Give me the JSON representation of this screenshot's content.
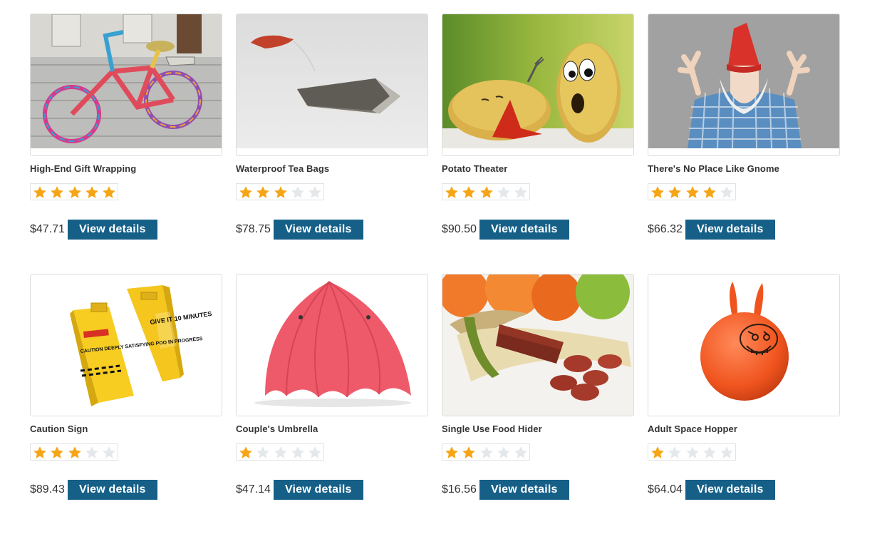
{
  "colors": {
    "star_filled": "#F5A515",
    "star_empty": "#E4E8EB",
    "button_bg": "#166088",
    "button_text": "#FFFFFF"
  },
  "products": [
    {
      "name": "High-End Gift Wrapping",
      "price": "$47.71",
      "rating": 5,
      "button": "View details",
      "image_icon": "knitted-bicycle-photo"
    },
    {
      "name": "Waterproof Tea Bags",
      "price": "$78.75",
      "rating": 3,
      "button": "View details",
      "image_icon": "tea-bag-photo"
    },
    {
      "name": "Potato Theater",
      "price": "$90.50",
      "rating": 3,
      "button": "View details",
      "image_icon": "potatoes-photo"
    },
    {
      "name": "There's No Place Like Gnome",
      "price": "$66.32",
      "rating": 4,
      "button": "View details",
      "image_icon": "gnome-man-photo"
    },
    {
      "name": "Caution Sign",
      "price": "$89.43",
      "rating": 3,
      "button": "View details",
      "image_icon": "caution-sign-photo"
    },
    {
      "name": "Couple's Umbrella",
      "price": "$47.14",
      "rating": 1,
      "button": "View details",
      "image_icon": "umbrella-photo"
    },
    {
      "name": "Single Use Food Hider",
      "price": "$16.56",
      "rating": 2,
      "button": "View details",
      "image_icon": "banana-sausage-photo"
    },
    {
      "name": "Adult Space Hopper",
      "price": "$64.04",
      "rating": 1,
      "button": "View details",
      "image_icon": "space-hopper-photo"
    }
  ],
  "caution_sign_text": {
    "left": "CAUTION DEEPLY SATISFYING POO IN PROGRESS",
    "right": "GIVE IT 10 MINUTES"
  }
}
